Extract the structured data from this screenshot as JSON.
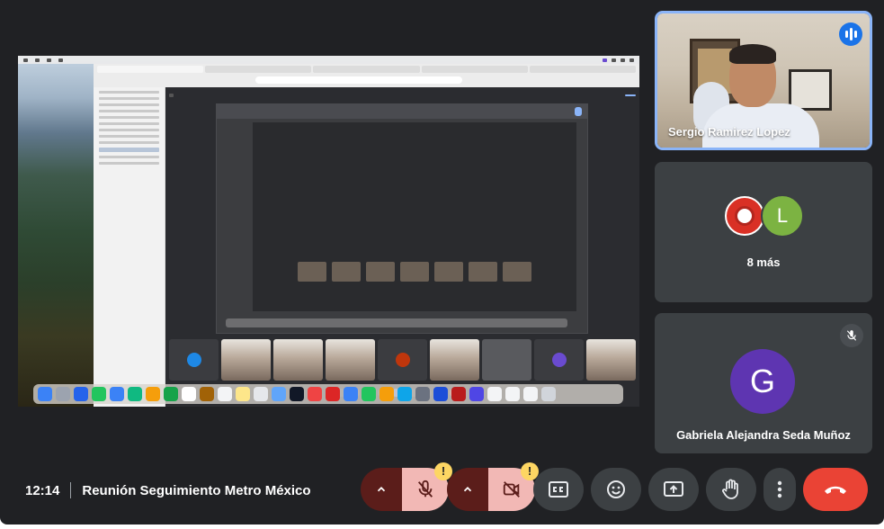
{
  "meeting": {
    "time": "12:14",
    "title": "Reunión Seguimiento Metro México"
  },
  "participants": {
    "active_speaker": {
      "name": "Sergio Ramirez Lopez",
      "speaking": true
    },
    "overflow": {
      "label": "8 más",
      "avatar_letter": "L"
    },
    "tile3": {
      "name": "Gabriela Alejandra Seda Muñoz",
      "avatar_letter": "G",
      "muted": true
    }
  },
  "controls": {
    "warning_glyph": "!",
    "icons": [
      "chevron-up-icon",
      "mic-off-icon",
      "camera-off-icon",
      "captions-icon",
      "emoji-icon",
      "present-icon",
      "raise-hand-icon",
      "more-vert-icon",
      "end-call-icon"
    ]
  },
  "colors": {
    "background": "#202124",
    "tile": "#3c4043",
    "speaker_border": "#8ab4f8",
    "end_call": "#ea4335",
    "muted_button": "#f2b8b5",
    "warning": "#fdd663",
    "avatar_g": "#5e35b1",
    "avatar_l": "#7cb342"
  }
}
